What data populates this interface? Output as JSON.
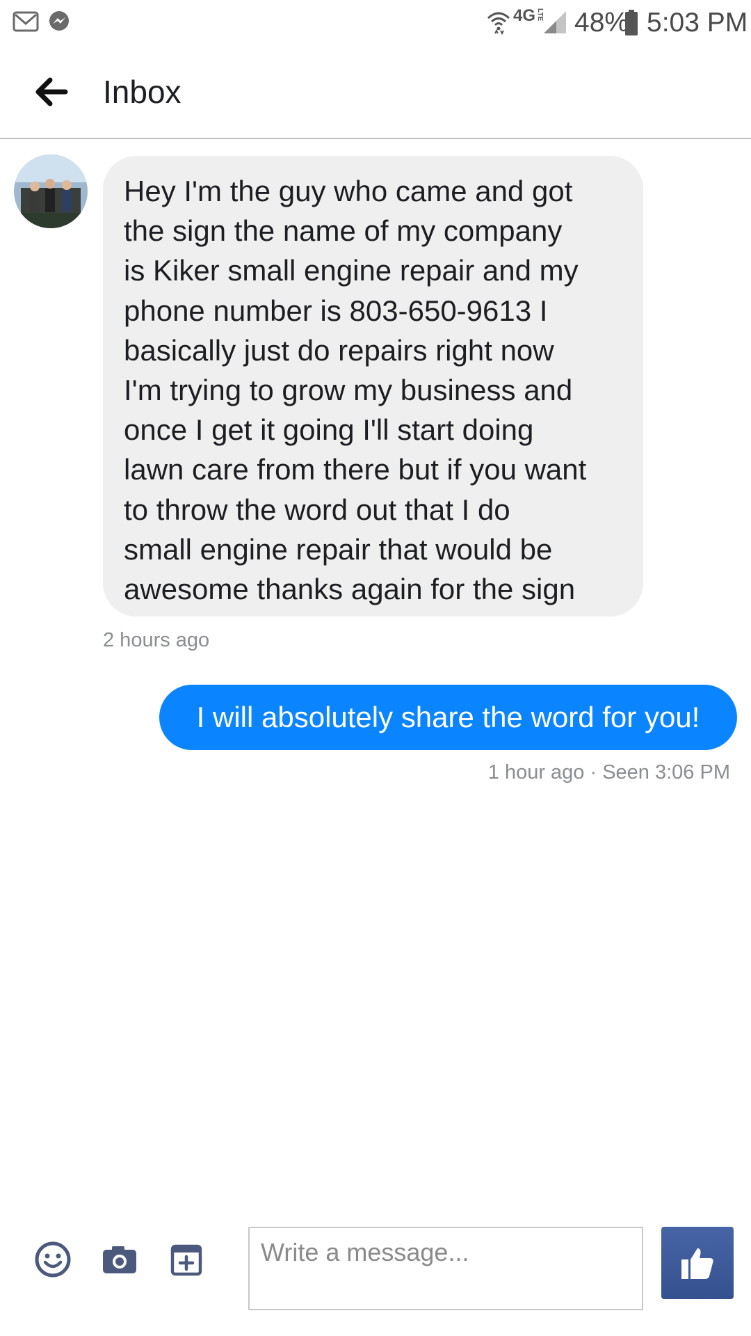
{
  "status_bar": {
    "network": "4G",
    "network_sub": "LTE",
    "battery": "48%",
    "time": "5:03 PM",
    "left_icons": [
      "gmail-icon",
      "messenger-icon"
    ],
    "right_icons": [
      "wifi-icon",
      "signal-icon",
      "battery-icon"
    ]
  },
  "header": {
    "title": "Inbox"
  },
  "thread": {
    "incoming": {
      "text": "Hey I'm the guy who came and got\nthe sign the name of my company\nis Kiker small engine repair and my\nphone number is 803-650-9613 I\nbasically just do repairs right now\nI'm trying to grow my business and\nonce I get it going I'll start doing\nlawn care from there but if you want\nto throw the word out that I do\nsmall engine repair that would be\nawesome thanks again for the sign",
      "time": "2 hours ago"
    },
    "outgoing": {
      "text": "I will absolutely share the word for you!",
      "meta": "1 hour ago · Seen 3:06 PM"
    }
  },
  "composer": {
    "placeholder": "Write a message...",
    "icons": [
      "emoji-icon",
      "camera-icon",
      "sticker-icon",
      "thumbs-up-icon"
    ]
  },
  "colors": {
    "outgoing_bubble": "#0a84ff",
    "incoming_bubble": "#efefef",
    "like_button": "#3b5998",
    "meta_text": "#8a8d91"
  }
}
